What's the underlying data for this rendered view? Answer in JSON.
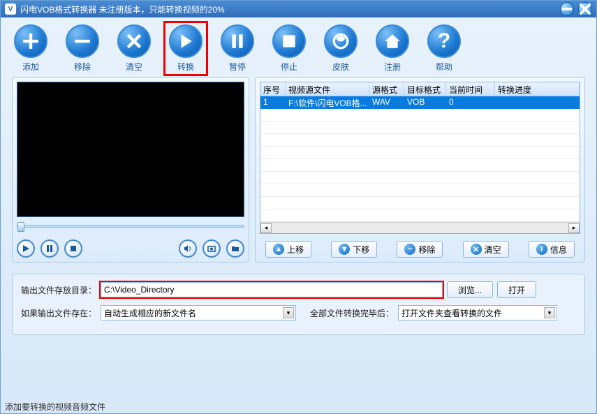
{
  "titlebar": {
    "title": "闪电VOB格式转换器   未注册版本，只能转换视频的20%"
  },
  "toolbar": {
    "add": "添加",
    "remove": "移除",
    "clear": "清空",
    "convert": "转换",
    "pause": "暂停",
    "stop": "停止",
    "skin": "皮肤",
    "register": "注册",
    "help": "帮助"
  },
  "table": {
    "headers": {
      "num": "序号",
      "source": "视频源文件",
      "srcfmt": "源格式",
      "dstfmt": "目标格式",
      "time": "当前时间",
      "progress": "转换进度"
    },
    "row": {
      "num": "1",
      "source": "F:\\软件\\闪电VOB格...",
      "srcfmt": "WAV",
      "dstfmt": "VOB",
      "time": "0",
      "progress": ""
    }
  },
  "listbtns": {
    "up": "上移",
    "down": "下移",
    "remove": "移除",
    "clear": "清空",
    "info": "信息"
  },
  "bottom": {
    "outpath_label": "输出文件存放目录：",
    "outpath_value": "C:\\Video_Directory",
    "browse": "浏览...",
    "open": "打开",
    "ifexist_label": "如果输出文件存在：",
    "ifexist_value": "自动生成相应的新文件名",
    "after_label": "全部文件转换完毕后：",
    "after_value": "打开文件夹查看转换的文件"
  },
  "statusbar": "添加要转换的视频音频文件"
}
